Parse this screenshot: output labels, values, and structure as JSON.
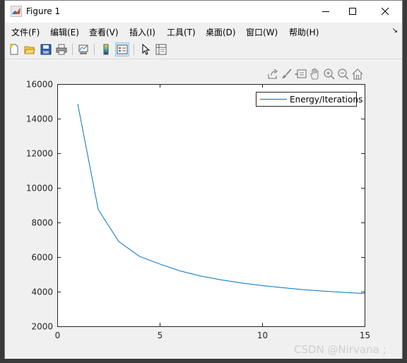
{
  "window": {
    "title": "Figure 1"
  },
  "menu": [
    {
      "label": "文件(F)"
    },
    {
      "label": "编辑(E)"
    },
    {
      "label": "查看(V)"
    },
    {
      "label": "插入(I)"
    },
    {
      "label": "工具(T)"
    },
    {
      "label": "桌面(D)"
    },
    {
      "label": "窗口(W)"
    },
    {
      "label": "帮助(H)"
    }
  ],
  "toolbar": {
    "icons": [
      "new-figure-icon",
      "open-file-icon",
      "save-icon",
      "print-icon",
      "link-plot-icon",
      "colorbar-icon",
      "legend-icon",
      "pointer-icon",
      "property-inspector-icon"
    ]
  },
  "axes_toolbar": {
    "icons": [
      "export-icon",
      "brush-icon",
      "data-tips-icon",
      "pan-icon",
      "zoom-in-icon",
      "zoom-out-icon",
      "home-icon"
    ]
  },
  "watermark": "CSDN @Nirvana ;",
  "colors": {
    "line": "#0072bd",
    "axes_bg": "#ffffff",
    "figure_bg": "#f0f0f0"
  },
  "chart_data": {
    "type": "line",
    "x": [
      1,
      2,
      3,
      4,
      5,
      6,
      7,
      8,
      9,
      10,
      11,
      12,
      13,
      14,
      15
    ],
    "series": [
      {
        "name": "Energy/Iterations",
        "values": [
          14850,
          8750,
          6900,
          6050,
          5600,
          5200,
          4900,
          4680,
          4500,
          4350,
          4230,
          4120,
          4030,
          3960,
          3890
        ]
      }
    ],
    "xlim": [
      0,
      15
    ],
    "ylim": [
      2000,
      16000
    ],
    "xticks": [
      0,
      5,
      10,
      15
    ],
    "yticks": [
      2000,
      4000,
      6000,
      8000,
      10000,
      12000,
      14000,
      16000
    ],
    "title": "",
    "xlabel": "",
    "ylabel": "",
    "legend": "top-right",
    "grid": false
  }
}
